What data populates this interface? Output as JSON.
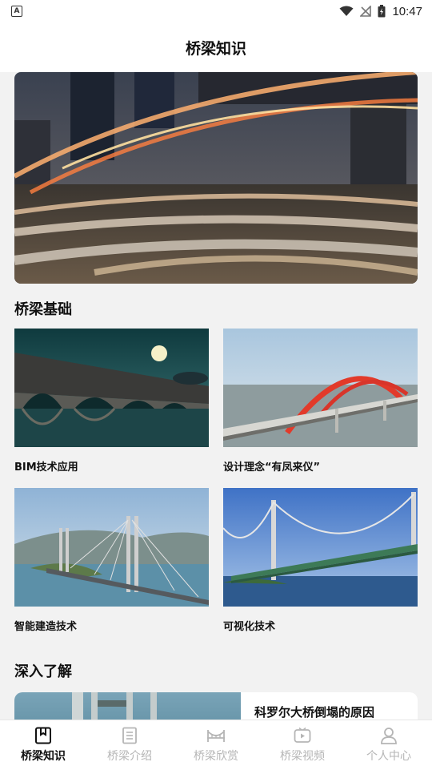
{
  "status_bar": {
    "time": "10:47",
    "left_badge": "A"
  },
  "header": {
    "title": "桥梁知识"
  },
  "section_basics": {
    "title": "桥梁基础",
    "cards": [
      {
        "label": "BIM技术应用"
      },
      {
        "label": "设计理念“有凤来仪”"
      },
      {
        "label": "智能建造技术"
      },
      {
        "label": "可视化技术"
      }
    ]
  },
  "section_deep": {
    "title": "深入了解",
    "items": [
      {
        "title": "科罗尔大桥倒塌的原因"
      }
    ]
  },
  "tabs": [
    {
      "label": "桥梁知识",
      "active": true
    },
    {
      "label": "桥梁介绍",
      "active": false
    },
    {
      "label": "桥梁欣赏",
      "active": false
    },
    {
      "label": "桥梁视频",
      "active": false
    },
    {
      "label": "个人中心",
      "active": false
    }
  ]
}
